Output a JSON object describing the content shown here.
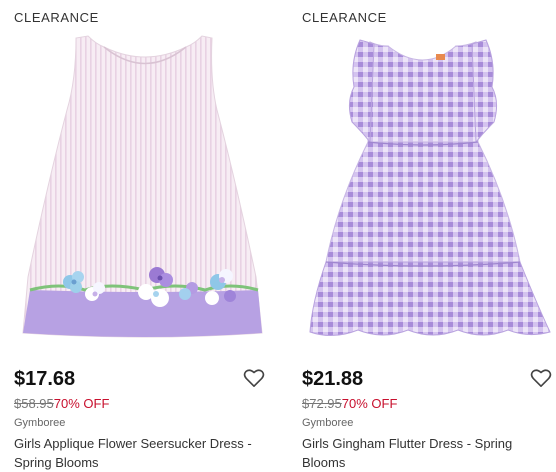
{
  "products": [
    {
      "badge": "CLEARANCE",
      "price": "$17.68",
      "original_price": "$58.95",
      "discount": "70% OFF",
      "brand": "Gymboree",
      "title": "Girls Applique Flower Seersucker Dress - Spring Blooms",
      "image": "seersucker dress with lavender hem and flower applique",
      "favorite_icon": "heart-outline-icon"
    },
    {
      "badge": "CLEARANCE",
      "price": "$21.88",
      "original_price": "$72.95",
      "discount": "70% OFF",
      "brand": "Gymboree",
      "title": "Girls Gingham Flutter Dress - Spring Blooms",
      "image": "lavender gingham flutter sleeve tiered dress",
      "favorite_icon": "heart-outline-icon"
    }
  ],
  "colors": {
    "price": "#111111",
    "discount": "#c8102e",
    "strike_price": "#777777",
    "lavender": "#b7a1e3",
    "dress_pink": "#f4e6f0"
  }
}
